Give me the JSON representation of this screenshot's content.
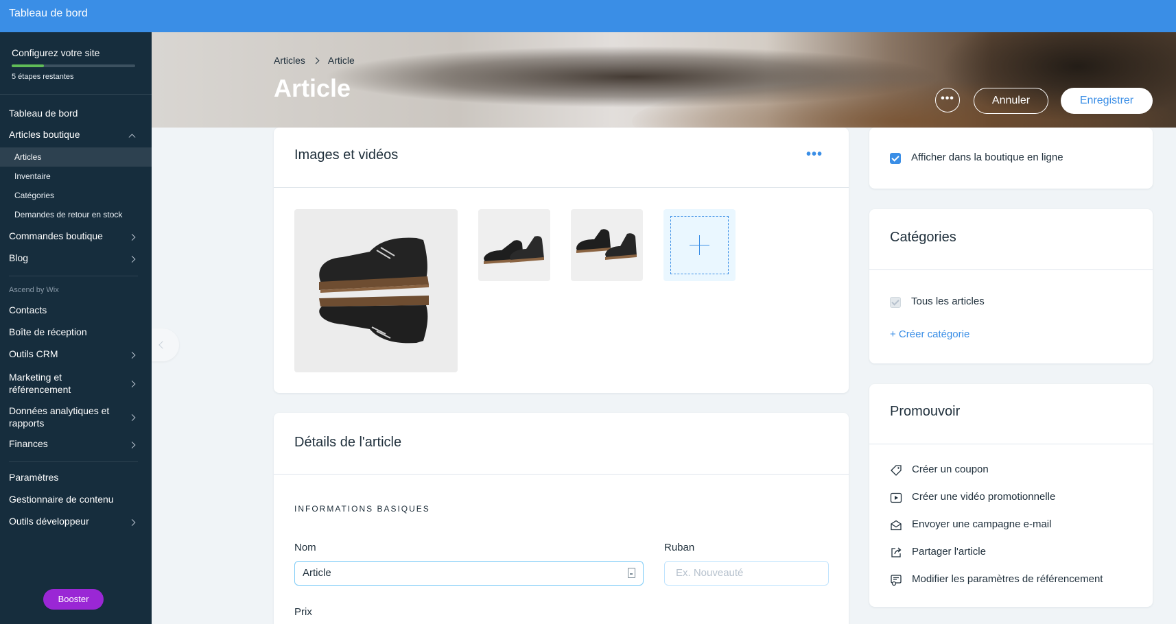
{
  "topbar": {
    "title": "Tableau de bord"
  },
  "setup": {
    "title": "Configurez votre site",
    "steps_remaining": "5 étapes restantes",
    "progress": 0.26
  },
  "sidebar": {
    "items": {
      "dashboard": "Tableau de bord",
      "store_products": "Articles boutique",
      "store_orders": "Commandes boutique",
      "blog": "Blog",
      "contacts": "Contacts",
      "inbox": "Boîte de réception",
      "crm_tools": "Outils CRM",
      "marketing": "Marketing et référencement",
      "analytics": "Données analytiques et rapports",
      "finances": "Finances",
      "settings": "Paramètres",
      "content_manager": "Gestionnaire de contenu",
      "dev_tools": "Outils développeur"
    },
    "sub_items": {
      "articles": "Articles",
      "inventory": "Inventaire",
      "categories": "Catégories",
      "back_in_stock": "Demandes de retour en stock"
    },
    "section_ascend": "Ascend by Wix",
    "boost_label": "Booster"
  },
  "header": {
    "breadcrumb_parent": "Articles",
    "breadcrumb_current": "Article",
    "title": "Article",
    "more_label": "•••",
    "cancel_label": "Annuler",
    "save_label": "Enregistrer"
  },
  "media": {
    "title": "Images et vidéos",
    "more_label": "•••"
  },
  "details": {
    "title": "Détails de l'article",
    "section": "INFORMATIONS BASIQUES",
    "name_label": "Nom",
    "name_value": "Article",
    "ribbon_label": "Ruban",
    "ribbon_placeholder": "Ex. Nouveauté",
    "price_label": "Prix"
  },
  "visibility": {
    "label": "Afficher dans la boutique en ligne",
    "checked": true
  },
  "categories": {
    "title": "Catégories",
    "all_label": "Tous les articles",
    "create_label": "+ Créer catégorie"
  },
  "promote": {
    "title": "Promouvoir",
    "items": [
      {
        "label": "Créer un coupon",
        "icon": "coupon-icon"
      },
      {
        "label": "Créer une vidéo promotionnelle",
        "icon": "video-icon"
      },
      {
        "label": "Envoyer une campagne e-mail",
        "icon": "email-icon"
      },
      {
        "label": "Partager l'article",
        "icon": "share-icon"
      },
      {
        "label": "Modifier les paramètres de référencement",
        "icon": "seo-settings-icon"
      }
    ]
  },
  "colors": {
    "accent": "#3a8ee6",
    "sidebar_bg": "#162d3d",
    "boost": "#9a27d5",
    "progress": "#60bc57"
  }
}
